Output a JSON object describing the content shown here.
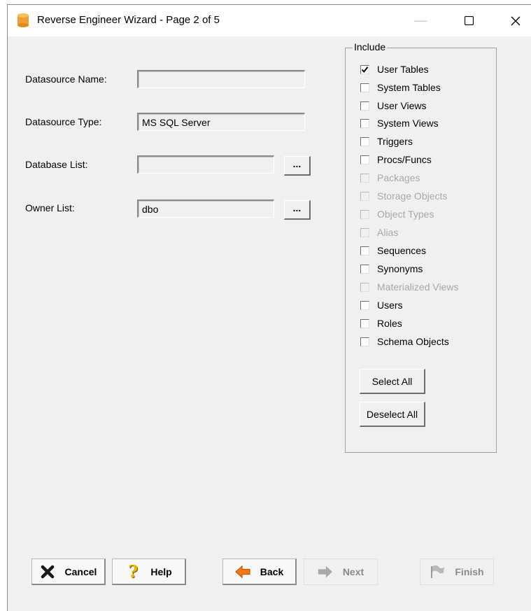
{
  "window": {
    "title": "Reverse Engineer Wizard - Page 2 of 5",
    "controls": {
      "minimize": "—",
      "maximize": "☐",
      "close": "✕"
    }
  },
  "form": {
    "datasource_name": {
      "label": "Datasource Name:",
      "value": ""
    },
    "datasource_type": {
      "label": "Datasource Type:",
      "value": "MS SQL Server"
    },
    "database_list": {
      "label": "Database List:",
      "value": "",
      "button": "..."
    },
    "owner_list": {
      "label": "Owner List:",
      "value": "dbo",
      "button": "..."
    }
  },
  "include": {
    "title": "Include",
    "items": [
      {
        "label": "User Tables",
        "checked": true,
        "enabled": true
      },
      {
        "label": "System Tables",
        "checked": false,
        "enabled": true
      },
      {
        "label": "User Views",
        "checked": false,
        "enabled": true
      },
      {
        "label": "System Views",
        "checked": false,
        "enabled": true
      },
      {
        "label": "Triggers",
        "checked": false,
        "enabled": true
      },
      {
        "label": "Procs/Funcs",
        "checked": false,
        "enabled": true
      },
      {
        "label": "Packages",
        "checked": false,
        "enabled": false
      },
      {
        "label": "Storage Objects",
        "checked": false,
        "enabled": false
      },
      {
        "label": "Object Types",
        "checked": false,
        "enabled": false
      },
      {
        "label": "Alias",
        "checked": false,
        "enabled": false
      },
      {
        "label": "Sequences",
        "checked": false,
        "enabled": true
      },
      {
        "label": "Synonyms",
        "checked": false,
        "enabled": true
      },
      {
        "label": "Materialized Views",
        "checked": false,
        "enabled": false
      },
      {
        "label": "Users",
        "checked": false,
        "enabled": true
      },
      {
        "label": "Roles",
        "checked": false,
        "enabled": true
      },
      {
        "label": "Schema Objects",
        "checked": false,
        "enabled": true
      }
    ],
    "select_all": "Select All",
    "deselect_all": "Deselect All"
  },
  "footer": {
    "cancel": "Cancel",
    "help": "Help",
    "back": "Back",
    "next": "Next",
    "finish": "Finish"
  },
  "colors": {
    "window_bg": "#f0f0f0",
    "titlebar_bg": "#ffffff",
    "disabled_text": "#a8a8a8",
    "cancel_icon": "#1a1a1a",
    "help_icon": "#e8b800",
    "back_arrow": "#e05a00",
    "app_icon": "#f0a030"
  }
}
